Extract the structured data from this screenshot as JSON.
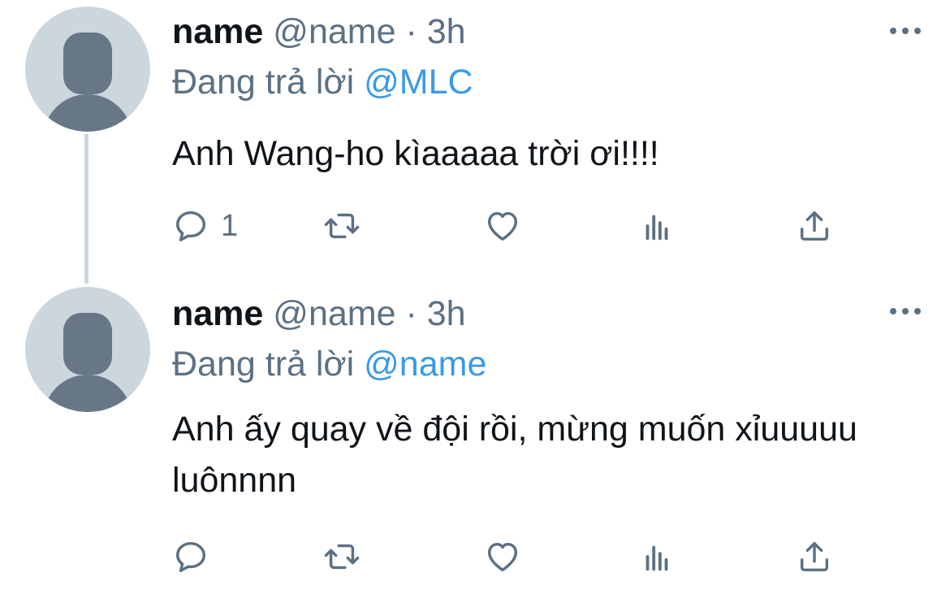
{
  "tweets": [
    {
      "display_name": "name",
      "handle": "@name",
      "separator": "·",
      "time": "3h",
      "replying_prefix": "Đang trả lời",
      "replying_to": "@MLC",
      "text": "Anh Wang-ho kìaaaaa trời ơi!!!!",
      "reply_count": "1",
      "icons": [
        "reply-icon",
        "retweet-icon",
        "like-icon",
        "stats-icon",
        "share-icon",
        "more-icon"
      ]
    },
    {
      "display_name": "name",
      "handle": "@name",
      "separator": "·",
      "time": "3h",
      "replying_prefix": "Đang trả lời",
      "replying_to": "@name",
      "text": "Anh ấy quay về đội rồi, mừng muốn xỉuuuuu luônnnn",
      "reply_count": "",
      "icons": [
        "reply-icon",
        "retweet-icon",
        "like-icon",
        "stats-icon",
        "share-icon",
        "more-icon"
      ]
    }
  ],
  "colors": {
    "text": "#0f1419",
    "secondary": "#5b7083",
    "mention": "#3a9ae6",
    "avatar_bg": "#ccd6dd",
    "avatar_fg": "#687786"
  }
}
